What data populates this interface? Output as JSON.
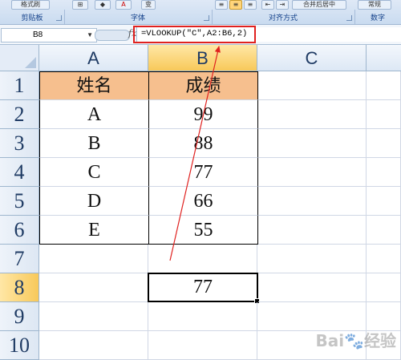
{
  "ribbon": {
    "clipboard_label": "剪贴板",
    "clipboard_btn": "格式刷",
    "font_label": "字体",
    "align_label": "对齐方式",
    "merge_btn": "合并后居中",
    "number_label": "数字",
    "number_btn": "常规"
  },
  "formula_bar": {
    "name_box": "B8",
    "fx": "fx",
    "formula": "=VLOOKUP(\"C\",A2:B6,2)"
  },
  "sheet": {
    "columns": [
      "A",
      "B",
      "C"
    ],
    "rows": [
      "1",
      "2",
      "3",
      "4",
      "5",
      "6",
      "7",
      "8",
      "9",
      "10"
    ],
    "cells": {
      "A1": "姓名",
      "B1": "成绩",
      "A2": "A",
      "B2": "99",
      "A3": "B",
      "B3": "88",
      "A4": "C",
      "B4": "77",
      "A5": "D",
      "B5": "66",
      "A6": "E",
      "B6": "55",
      "B8": "77"
    },
    "selected_cell": "B8",
    "header_fill": "#f6bf8e",
    "annotation_color": "#e0211f"
  },
  "watermark": {
    "text": "Bai",
    "text2": "经验"
  }
}
